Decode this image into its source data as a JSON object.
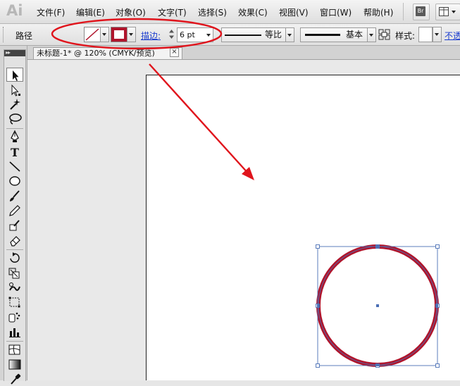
{
  "app": {
    "logo": "Ai",
    "menu": [
      "文件(F)",
      "编辑(E)",
      "对象(O)",
      "文字(T)",
      "选择(S)",
      "效果(C)",
      "视图(V)",
      "窗口(W)",
      "帮助(H)"
    ],
    "bridge_button": "Br"
  },
  "control_bar": {
    "context_label": "路径",
    "stroke_link_label": "描边:",
    "stroke_weight": "6 pt",
    "profile_label": "等比",
    "brush_label": "基本",
    "style_label": "样式:",
    "opacity_link": "不透"
  },
  "document": {
    "tab_title": "未标题-1* @ 120% (CMYK/预览)",
    "tab_close": "×"
  },
  "toolbox": {
    "collapse_label": "▸▸",
    "tools": [
      "selection",
      "direct-selection",
      "magic-wand",
      "lasso",
      "pen",
      "type",
      "line-segment",
      "ellipse",
      "paintbrush",
      "pencil",
      "blob-brush",
      "eraser",
      "rotate",
      "scale",
      "warp",
      "free-transform",
      "symbol-sprayer",
      "column-graph",
      "mesh",
      "gradient",
      "eyedropper"
    ]
  },
  "colors": {
    "stroke_color": "#b0152c",
    "annotation_red": "#e0141c",
    "selection_blue": "#4a6fb5"
  },
  "artwork": {
    "shape": "circle",
    "stroke_weight_pt": 6,
    "selected": true
  }
}
